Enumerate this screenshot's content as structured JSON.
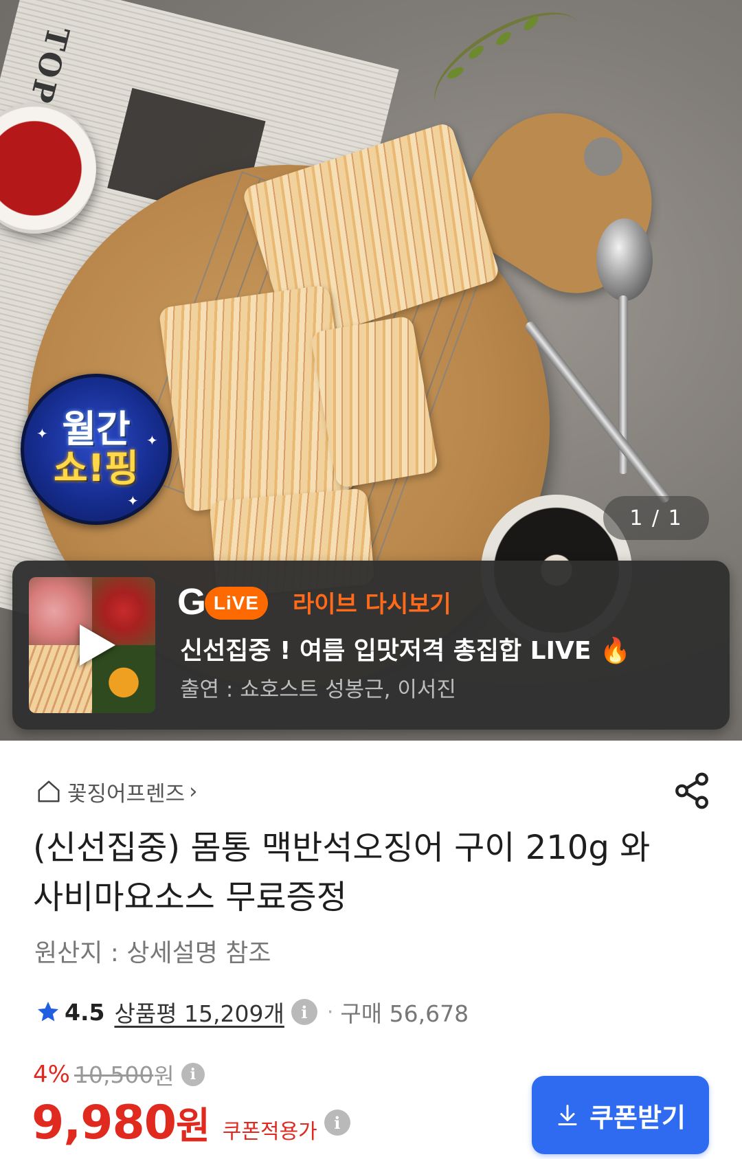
{
  "hero": {
    "newspaper_headline": "TOP SEL",
    "badge": {
      "line1": "월간",
      "line2": "쇼!핑"
    },
    "image_counter": "1 / 1"
  },
  "live": {
    "logo_g": "G",
    "logo_live": "LiVE",
    "replay_label": "라이브 다시보기",
    "title": "신선집중 ! 여름 입맛저격 총집합 LIVE 🔥",
    "cast": "출연 : 쇼호스트 성봉근, 이서진"
  },
  "store": {
    "name": "꽃징어프렌즈",
    "chevron": "›"
  },
  "product": {
    "title": "(신선집중) 몸통 맥반석오징어 구이 210g 와사비마요소스 무료증정",
    "origin": "원산지 : 상세설명 참조"
  },
  "rating": {
    "score": "4.5",
    "reviews": "상품평 15,209개",
    "separator": "·",
    "purchases": "구매 56,678"
  },
  "price": {
    "discount_rate": "4%",
    "original": "10,500",
    "original_unit": "원",
    "final": "9,980",
    "final_unit": "원",
    "coupon_applied": "쿠폰적용가"
  },
  "coupon_button": {
    "label": "쿠폰받기"
  },
  "colors": {
    "accent_red": "#e0291f",
    "button_blue": "#2f6bf0",
    "live_orange": "#ff6a1a",
    "star_blue": "#1f5fe0"
  }
}
